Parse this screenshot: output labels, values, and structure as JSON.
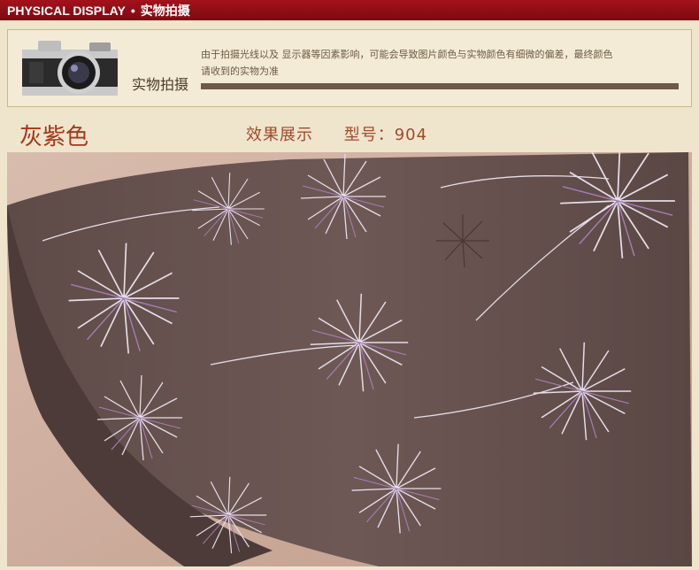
{
  "header": {
    "title_en": "PHYSICAL DISPLAY",
    "separator": "•",
    "title_cn": "实物拍摄"
  },
  "notice": {
    "label": "实物拍摄",
    "line1": "由于拍摄光线以及 显示器等因素影响，可能会导致图片颜色与实物颜色有细微的偏差，最终颜色",
    "line2": "请收到的实物为准"
  },
  "product": {
    "color_name": "灰紫色",
    "caption": "效果展示",
    "model_label": "型号：",
    "model_number": "904"
  },
  "colors": {
    "header_red": "#8e0f16",
    "accent_orange": "#a4371a",
    "wallpaper_brown": "#6b5450",
    "wall_pink": "#cfb1a0"
  },
  "icons": {
    "camera": "camera-icon"
  }
}
